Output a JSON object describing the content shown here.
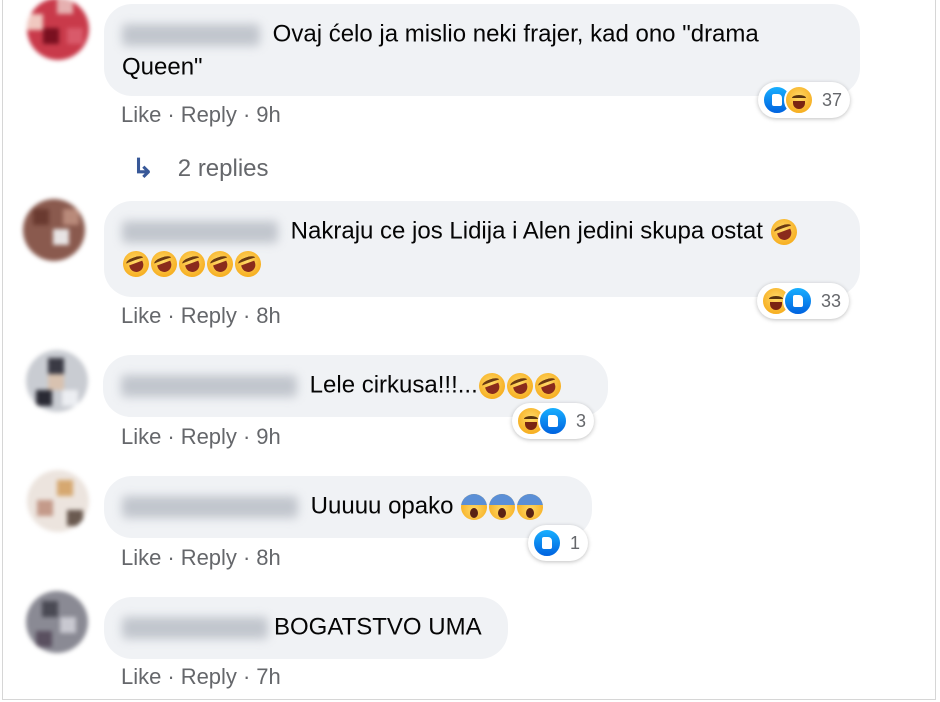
{
  "comments": [
    {
      "text": "Ovaj ćelo ja mislio neki frajer, kad ono \"drama Queen\"",
      "text_line1": "Ovaj ćelo ja mislio neki frajer, kad ono \"drama",
      "text_line2": "Queen\"",
      "like": "Like",
      "reply": "Reply",
      "time": "9h",
      "reaction_count": "37"
    },
    {
      "text_line1": "Nakraju ce jos Lidija i Alen jedini skupa ostat",
      "like": "Like",
      "reply": "Reply",
      "time": "8h",
      "reaction_count": "33"
    },
    {
      "text_line1": "Lele cirkusa!!!...",
      "like": "Like",
      "reply": "Reply",
      "time": "9h",
      "reaction_count": "3"
    },
    {
      "text_line1": "Uuuuu opako",
      "like": "Like",
      "reply": "Reply",
      "time": "8h",
      "reaction_count": "1"
    },
    {
      "text_line1": "BOGATSTVO UMA",
      "like": "Like",
      "reply": "Reply",
      "time": "7h"
    }
  ],
  "replies_link": {
    "icon": "reply-arrow-icon",
    "label": "2 replies"
  },
  "separator": "·",
  "colors": {
    "bubble": "#f0f2f5",
    "meta": "#65676b",
    "like_blue": "#1877f2"
  }
}
